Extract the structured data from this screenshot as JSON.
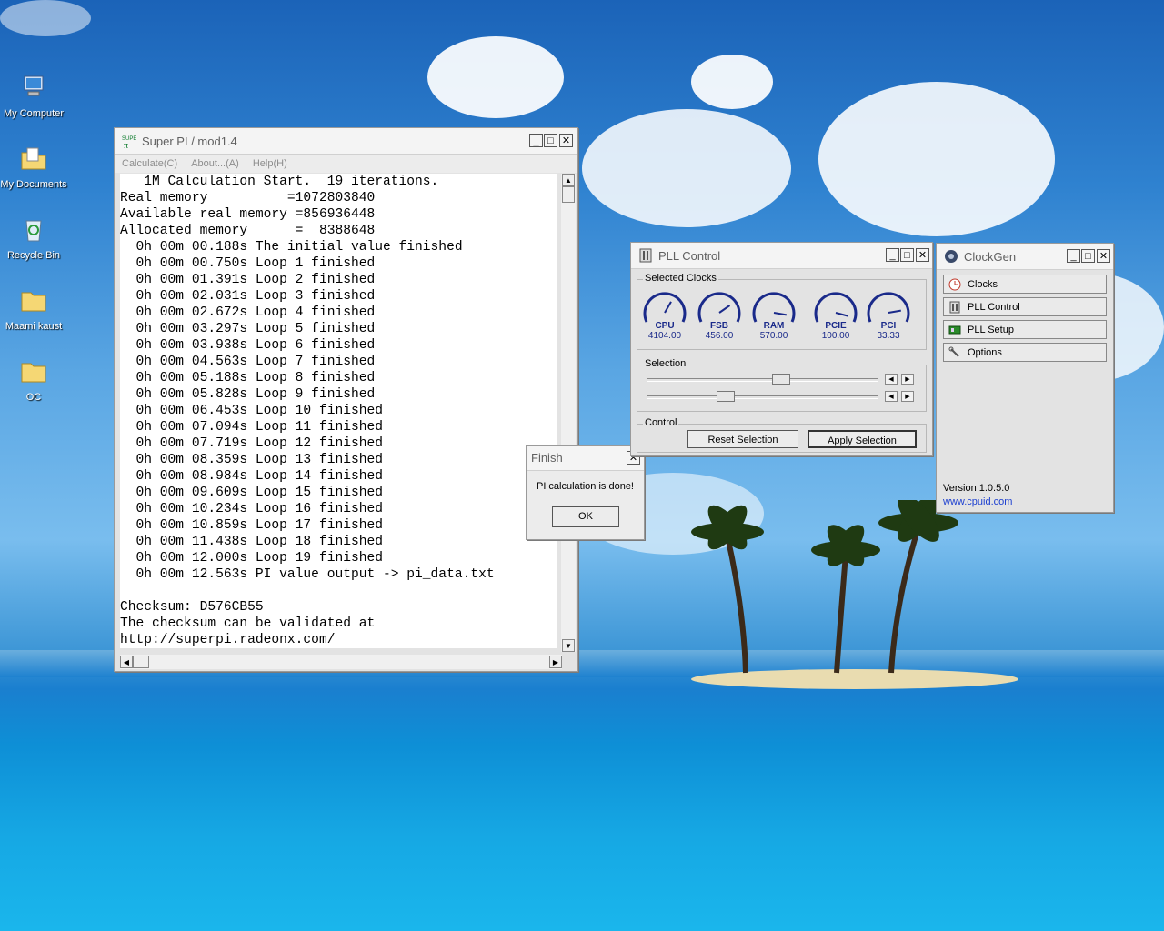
{
  "desktop": {
    "icons": [
      {
        "label": "My Computer",
        "icon": "computer-icon"
      },
      {
        "label": "My Documents",
        "icon": "documents-icon"
      },
      {
        "label": "Recycle Bin",
        "icon": "recycle-bin-icon"
      },
      {
        "label": "Maami kaust",
        "icon": "folder-icon"
      },
      {
        "label": "OC",
        "icon": "folder-icon"
      }
    ]
  },
  "superpi": {
    "title": "Super PI / mod1.4",
    "menu": [
      "Calculate(C)",
      "About...(A)",
      "Help(H)"
    ],
    "lines": [
      "   1M Calculation Start.  19 iterations.",
      "Real memory          =1072803840",
      "Available real memory =856936448",
      "Allocated memory      =  8388648",
      "  0h 00m 00.188s The initial value finished",
      "  0h 00m 00.750s Loop 1 finished",
      "  0h 00m 01.391s Loop 2 finished",
      "  0h 00m 02.031s Loop 3 finished",
      "  0h 00m 02.672s Loop 4 finished",
      "  0h 00m 03.297s Loop 5 finished",
      "  0h 00m 03.938s Loop 6 finished",
      "  0h 00m 04.563s Loop 7 finished",
      "  0h 00m 05.188s Loop 8 finished",
      "  0h 00m 05.828s Loop 9 finished",
      "  0h 00m 06.453s Loop 10 finished",
      "  0h 00m 07.094s Loop 11 finished",
      "  0h 00m 07.719s Loop 12 finished",
      "  0h 00m 08.359s Loop 13 finished",
      "  0h 00m 08.984s Loop 14 finished",
      "  0h 00m 09.609s Loop 15 finished",
      "  0h 00m 10.234s Loop 16 finished",
      "  0h 00m 10.859s Loop 17 finished",
      "  0h 00m 11.438s Loop 18 finished",
      "  0h 00m 12.000s Loop 19 finished",
      "  0h 00m 12.563s PI value output -> pi_data.txt",
      "",
      "Checksum: D576CB55",
      "The checksum can be validated at",
      "http://superpi.radeonx.com/"
    ]
  },
  "finish_dialog": {
    "title": "Finish",
    "message": "PI calculation is done!",
    "ok_label": "OK"
  },
  "pll": {
    "title": "PLL Control",
    "selected_clocks_label": "Selected Clocks",
    "gauges": [
      {
        "name": "CPU",
        "value": "4104.00"
      },
      {
        "name": "FSB",
        "value": "456.00"
      },
      {
        "name": "RAM",
        "value": "570.00"
      },
      {
        "name": "PCIE",
        "value": "100.00"
      },
      {
        "name": "PCI",
        "value": "33.33"
      }
    ],
    "selection_label": "Selection",
    "control_label": "Control",
    "reset_label": "Reset Selection",
    "apply_label": "Apply Selection"
  },
  "clockgen": {
    "title": "ClockGen",
    "nav": [
      {
        "label": "Clocks",
        "icon": "clock-icon"
      },
      {
        "label": "PLL Control",
        "icon": "pll-icon"
      },
      {
        "label": "PLL Setup",
        "icon": "chip-icon"
      },
      {
        "label": "Options",
        "icon": "wrench-icon"
      }
    ],
    "version": "Version 1.0.5.0",
    "link": "www.cpuid.com"
  },
  "colors": {
    "gauge": "#1a2a8a",
    "link": "#1c3fd0"
  }
}
